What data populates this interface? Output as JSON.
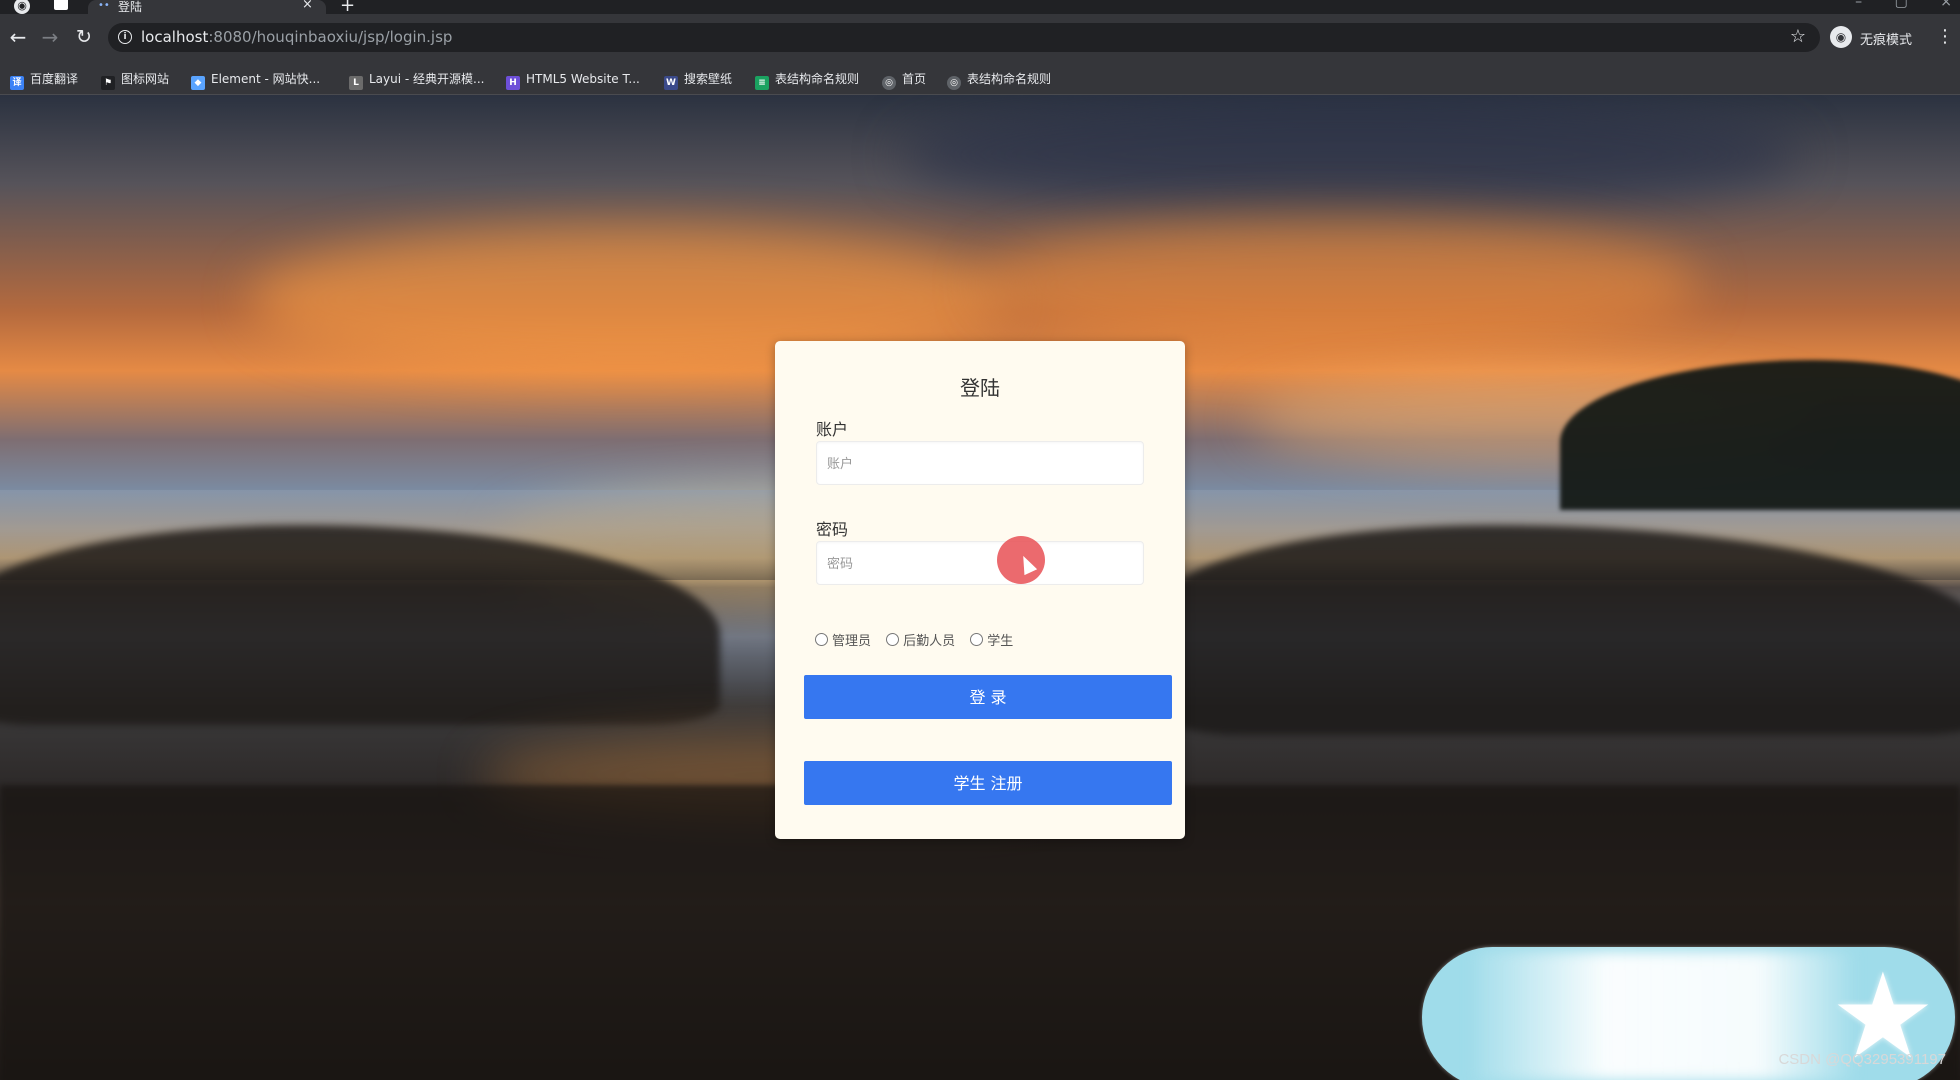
{
  "browser": {
    "tab_title": "登陆",
    "url_host": "localhost",
    "url_path": ":8080/houqinbaoxiu/jsp/login.jsp",
    "profile_label": "无痕模式",
    "icons": {
      "back": "←",
      "forward": "→",
      "reload": "↻",
      "info": "i",
      "star": "☆",
      "menu": "⋮",
      "new_tab": "+",
      "close": "×",
      "profile": "◉"
    },
    "bookmarks": [
      {
        "label": "百度翻译",
        "icon": "译",
        "color": "#3b82f6"
      },
      {
        "label": "图标网站",
        "icon": "⚑",
        "color": "#202124"
      },
      {
        "label": "Element - 网站快...",
        "icon": "◆",
        "color": "#5aa4ff"
      },
      {
        "label": "Layui - 经典开源模...",
        "icon": "L",
        "color": "#6b6b6b"
      },
      {
        "label": "HTML5 Website T...",
        "icon": "H",
        "color": "#6d4fd8"
      },
      {
        "label": "搜索壁纸",
        "icon": "W",
        "color": "#3b4a8a"
      },
      {
        "label": "表结构命名规则",
        "icon": "≡",
        "color": "#1aa260"
      },
      {
        "label": "首页",
        "icon": "◎",
        "color": "#5f6368"
      },
      {
        "label": "表结构命名规则",
        "icon": "◎",
        "color": "#5f6368"
      }
    ]
  },
  "login": {
    "title": "登陆",
    "account_label": "账户",
    "account_placeholder": "账户",
    "password_label": "密码",
    "password_placeholder": "密码",
    "roles": [
      "管理员",
      "后勤人员",
      "学生"
    ],
    "login_button": "登 录",
    "register_button": "学生 注册"
  },
  "colors": {
    "primary_button": "#3677f0",
    "card_background": "#fffbf0",
    "cursor_highlight": "#e8555a",
    "float_widget": "#9fdcea"
  },
  "watermark": "CSDN @QQ3295391197"
}
